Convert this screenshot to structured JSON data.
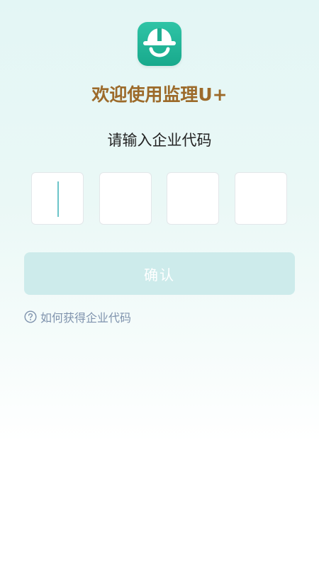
{
  "app": {
    "logo_icon": "smiling-hardhat-icon",
    "brand_color": "#22b596",
    "title": "欢迎使用监理U+",
    "title_color": "#9c6a2a"
  },
  "code_entry": {
    "prompt": "请输入企业代码",
    "boxes": [
      "",
      "",
      "",
      ""
    ]
  },
  "actions": {
    "confirm_label": "确认",
    "confirm_bg": "#cdebeb"
  },
  "help": {
    "icon": "question-circle-icon",
    "text": "如何获得企业代码"
  }
}
